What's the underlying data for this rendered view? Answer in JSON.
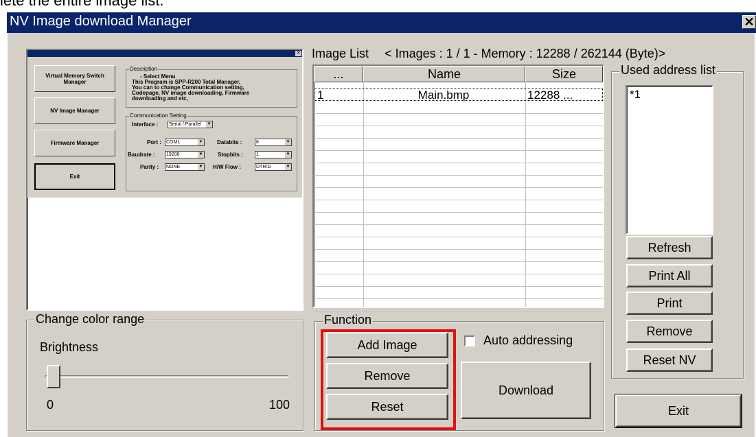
{
  "top_caption": "lete the entire image list.",
  "window": {
    "title": "NV Image download Manager",
    "close_glyph": "✕"
  },
  "preview": {
    "menu_buttons": [
      {
        "label": "Virtual Memory Switch Manager"
      },
      {
        "label": "NV Image Manager"
      },
      {
        "label": "Firmware Manager"
      },
      {
        "label": "Exit"
      }
    ],
    "description_label": "Description",
    "description_text": [
      "- Select Menu",
      "This Program is SPP-R200 Total Manager,",
      "You can to change Communication setting,",
      "Codepage, NV image downloading, Firmware",
      "downloading and etc,"
    ],
    "comm_label": "Communication Setting",
    "interface_label": "Interface :",
    "interface_value": "Serial / Parallel",
    "port_label": "Port :",
    "port_value": "COM1",
    "databits_label": "Databits :",
    "databits_value": "8",
    "baudrate_label": "Baudrate :",
    "baudrate_value": "19200",
    "stopbits_label": "Stopbits :",
    "stopbits_value": "1",
    "parity_label": "Parity :",
    "parity_value": "NONE",
    "hwflow_label": "H/W Flow :",
    "hwflow_value": "DTR/D"
  },
  "image_list": {
    "title": "Image List",
    "summary": "< Images : 1 / 1 - Memory : 12288 / 262144 (Byte)>",
    "columns": [
      "...",
      "Name",
      "Size"
    ],
    "rows": [
      {
        "index": "1",
        "name": "Main.bmp",
        "size": "12288 ..."
      }
    ]
  },
  "used_address": {
    "label": "Used address list",
    "items": [
      "*1"
    ]
  },
  "side_buttons": {
    "refresh": "Refresh",
    "print_all": "Print All",
    "print": "Print",
    "remove": "Remove",
    "reset_nv": "Reset NV",
    "exit": "Exit"
  },
  "color_range": {
    "label": "Change color range",
    "brightness_label": "Brightness",
    "min_label": "0",
    "max_label": "100",
    "brightness_value": 0
  },
  "function": {
    "label": "Function",
    "add_image": "Add Image",
    "remove": "Remove",
    "reset": "Reset",
    "auto_addressing": "Auto addressing",
    "auto_addressing_checked": false,
    "download": "Download"
  },
  "colors": {
    "titlebar": "#0a246a",
    "face": "#d4d0c8",
    "highlight_box": "#e01010"
  }
}
